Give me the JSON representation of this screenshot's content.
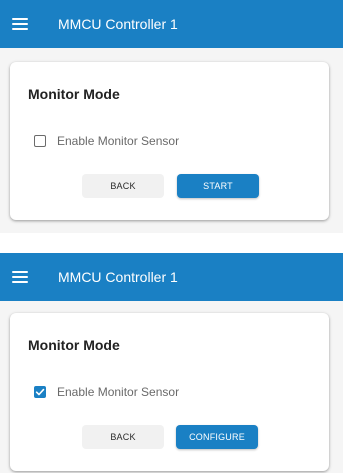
{
  "colors": {
    "primary": "#1a80c4",
    "background": "#f5f5f5",
    "card": "#ffffff"
  },
  "screens": [
    {
      "appbar": {
        "menu_icon": "hamburger-menu-icon",
        "title": "MMCU Controller 1"
      },
      "card": {
        "title": "Monitor Mode",
        "checkbox": {
          "label": "Enable Monitor Sensor",
          "checked": false
        },
        "back_label": "BACK",
        "primary_label": "START"
      }
    },
    {
      "appbar": {
        "menu_icon": "hamburger-menu-icon",
        "title": "MMCU Controller 1"
      },
      "card": {
        "title": "Monitor Mode",
        "checkbox": {
          "label": "Enable Monitor Sensor",
          "checked": true
        },
        "back_label": "BACK",
        "primary_label": "CONFIGURE"
      }
    }
  ]
}
